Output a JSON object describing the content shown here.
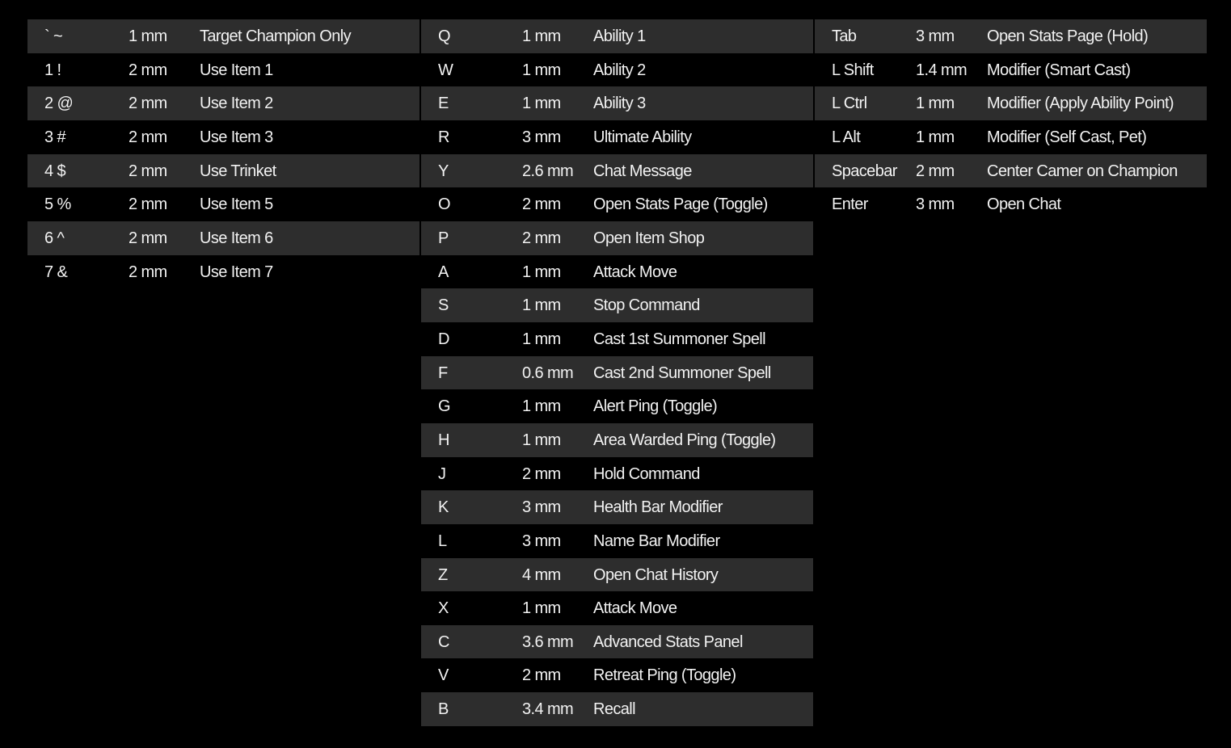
{
  "colors": {
    "background": "#000000",
    "stripe": "#2d2d2d",
    "text": "#f2f2f2"
  },
  "columns": [
    {
      "rows": [
        {
          "key": "` ~",
          "travel": "1 mm",
          "action": "Target Champion Only"
        },
        {
          "key": "1 !",
          "travel": "2 mm",
          "action": "Use Item 1"
        },
        {
          "key": "2 @",
          "travel": "2 mm",
          "action": "Use Item 2"
        },
        {
          "key": "3 #",
          "travel": "2 mm",
          "action": "Use Item 3"
        },
        {
          "key": "4 $",
          "travel": "2 mm",
          "action": "Use Trinket"
        },
        {
          "key": "5 %",
          "travel": "2 mm",
          "action": "Use Item 5"
        },
        {
          "key": "6 ^",
          "travel": "2 mm",
          "action": "Use Item 6"
        },
        {
          "key": "7 &",
          "travel": "2 mm",
          "action": "Use Item 7"
        }
      ]
    },
    {
      "rows": [
        {
          "key": "Q",
          "travel": "1 mm",
          "action": "Ability 1"
        },
        {
          "key": "W",
          "travel": "1 mm",
          "action": "Ability 2"
        },
        {
          "key": "E",
          "travel": "1 mm",
          "action": "Ability 3"
        },
        {
          "key": "R",
          "travel": "3 mm",
          "action": "Ultimate Ability"
        },
        {
          "key": "Y",
          "travel": "2.6 mm",
          "action": "Chat Message"
        },
        {
          "key": "O",
          "travel": "2 mm",
          "action": "Open Stats Page (Toggle)"
        },
        {
          "key": "P",
          "travel": "2 mm",
          "action": "Open Item Shop"
        },
        {
          "key": "A",
          "travel": "1 mm",
          "action": "Attack Move"
        },
        {
          "key": "S",
          "travel": "1 mm",
          "action": "Stop Command"
        },
        {
          "key": "D",
          "travel": "1 mm",
          "action": "Cast 1st Summoner Spell"
        },
        {
          "key": "F",
          "travel": "0.6  mm",
          "action": "Cast 2nd Summoner Spell"
        },
        {
          "key": "G",
          "travel": "1 mm",
          "action": "Alert Ping (Toggle)"
        },
        {
          "key": "H",
          "travel": "1 mm",
          "action": "Area Warded Ping (Toggle)"
        },
        {
          "key": "J",
          "travel": "2 mm",
          "action": "Hold Command"
        },
        {
          "key": "K",
          "travel": "3 mm",
          "action": "Health Bar Modifier"
        },
        {
          "key": "L",
          "travel": "3 mm",
          "action": "Name Bar Modifier"
        },
        {
          "key": "Z",
          "travel": "4 mm",
          "action": "Open Chat History"
        },
        {
          "key": "X",
          "travel": "1 mm",
          "action": "Attack Move"
        },
        {
          "key": "C",
          "travel": "3.6 mm",
          "action": "Advanced Stats Panel"
        },
        {
          "key": "V",
          "travel": "2  mm",
          "action": "Retreat Ping (Toggle)"
        },
        {
          "key": "B",
          "travel": "3.4 mm",
          "action": "Recall"
        }
      ]
    },
    {
      "rows": [
        {
          "key": "Tab",
          "travel": "3 mm",
          "action": "Open Stats Page (Hold)"
        },
        {
          "key": "L Shift",
          "travel": "1.4 mm",
          "action": "Modifier (Smart Cast)"
        },
        {
          "key": "L Ctrl",
          "travel": "1 mm",
          "action": "Modifier (Apply Ability Point)"
        },
        {
          "key": "L Alt",
          "travel": "1 mm",
          "action": "Modifier (Self Cast, Pet)"
        },
        {
          "key": "Spacebar",
          "travel": "2 mm",
          "action": "Center Camer on Champion"
        },
        {
          "key": "Enter",
          "travel": "3 mm",
          "action": "Open Chat"
        }
      ]
    }
  ]
}
